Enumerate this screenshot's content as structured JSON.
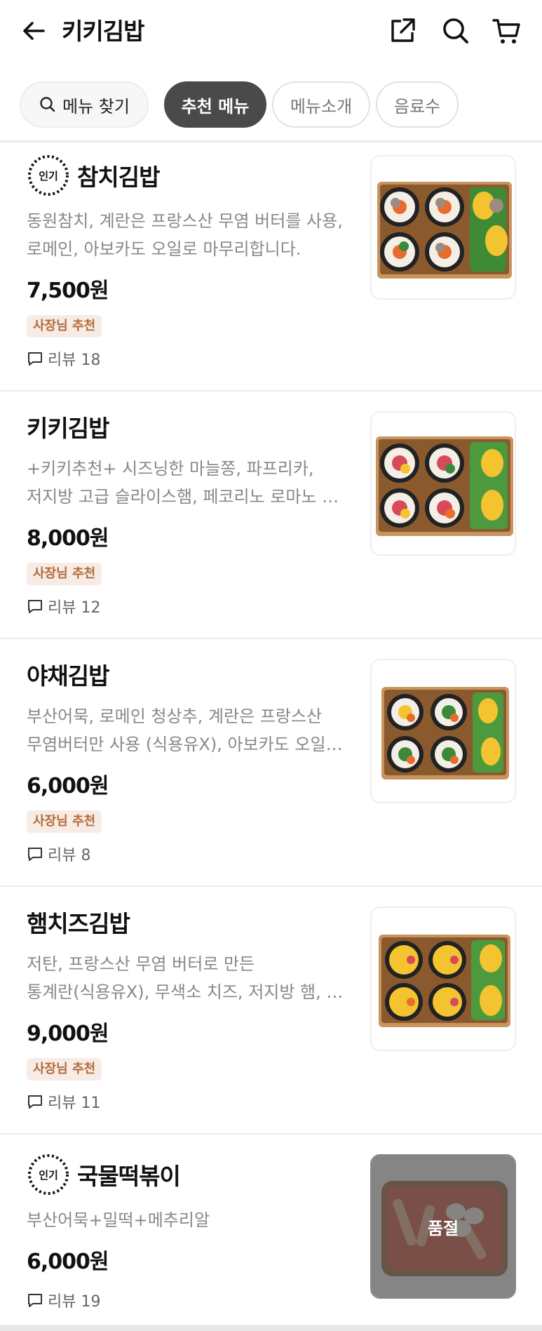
{
  "header": {
    "title": "키키김밥",
    "icons": [
      "back-arrow-icon",
      "share-icon",
      "search-icon",
      "cart-icon"
    ]
  },
  "tabs": {
    "search_label": "메뉴 찾기",
    "items": [
      "추천 메뉴",
      "메뉴소개",
      "음료수"
    ],
    "active_index": 0
  },
  "colors": {
    "active_chip": "#4a4a4a",
    "tag_bg": "#f7ece5",
    "tag_text": "#b46a3a"
  },
  "menu": [
    {
      "popular": true,
      "popular_label": "인기",
      "name": "참치김밥",
      "desc_line1": "동원참치, 계란은 프랑스산 무염 버터를 사용,",
      "desc_line2": "로메인, 아보카도 오일로 마무리합니다.",
      "price": "7,500원",
      "tag": "사장님 추천",
      "review": "리뷰 18",
      "sold_out": false
    },
    {
      "popular": false,
      "name": "키키김밥",
      "desc_line1": "+키키추천+ 시즈닝한 마늘쫑, 파프리카,",
      "desc_line2": "저지방 고급 슬라이스햄, 페코리노 로마노 치…",
      "price": "8,000원",
      "tag": "사장님 추천",
      "review": "리뷰 12",
      "sold_out": false
    },
    {
      "popular": false,
      "name": "야채김밥",
      "desc_line1": "부산어묵, 로메인 청상추, 계란은 프랑스산",
      "desc_line2": "무염버터만 사용 (식용유X), 아보카도 오일…",
      "price": "6,000원",
      "tag": "사장님 추천",
      "review": "리뷰 8",
      "sold_out": false
    },
    {
      "popular": false,
      "name": "햄치즈김밥",
      "desc_line1": "저탄, 프랑스산 무염 버터로 만든",
      "desc_line2": "통계란(식용유X), 무색소 치즈, 저지방 햄, …",
      "price": "9,000원",
      "tag": "사장님 추천",
      "review": "리뷰 11",
      "sold_out": false
    },
    {
      "popular": true,
      "popular_label": "인기",
      "name": "국물떡볶이",
      "desc_line1": "부산어묵+밀떡+메추리알",
      "desc_line2": "",
      "price": "6,000원",
      "tag": "",
      "review": "리뷰 19",
      "sold_out": true,
      "sold_out_label": "품절"
    }
  ]
}
